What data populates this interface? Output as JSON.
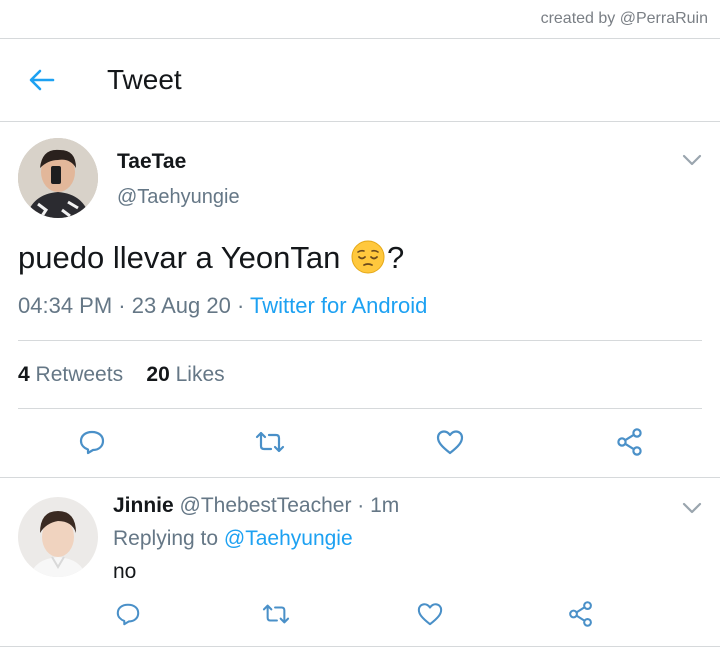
{
  "watermark": "created by @PerraRuin",
  "header": {
    "title": "Tweet"
  },
  "tweet": {
    "name": "TaeTae",
    "handle": "@Taehyungie",
    "text_before": "puedo llevar a YeonTan",
    "text_after": "?",
    "emoji": "pensive-face",
    "time": "04:34 PM",
    "date": "23 Aug 20",
    "separator": "·",
    "source": "Twitter for Android",
    "retweets_count": "4",
    "retweets_label": "Retweets",
    "likes_count": "20",
    "likes_label": "Likes"
  },
  "reply": {
    "name": "Jinnie",
    "handle": "@ThebestTeacher",
    "time": "1m",
    "replying_label": "Replying to",
    "replying_handle": "@Taehyungie",
    "text": "no"
  },
  "icons": {
    "back": "arrow-left-icon",
    "chevron": "chevron-down-icon",
    "reply": "reply-icon",
    "retweet": "retweet-icon",
    "like": "heart-icon",
    "share": "share-icon"
  },
  "colors": {
    "accent": "#1da1f2",
    "secondary_text": "#657786",
    "action_icon": "#4a90c8",
    "divider": "#d6d9db"
  }
}
